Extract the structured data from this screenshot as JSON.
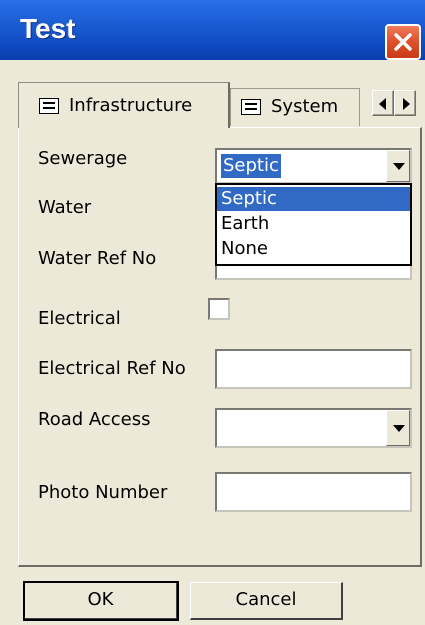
{
  "window": {
    "title": "Test"
  },
  "tabs": [
    {
      "label": "Infrastructure",
      "active": true
    },
    {
      "label": "System",
      "active": false
    }
  ],
  "form": {
    "sewerage": {
      "label": "Sewerage",
      "value": "Septic"
    },
    "water": {
      "label": "Water"
    },
    "water_ref_no": {
      "label": "Water Ref No"
    },
    "electrical": {
      "label": "Electrical",
      "checked": false
    },
    "electrical_ref_no": {
      "label": "Electrical Ref No",
      "value": ""
    },
    "road_access": {
      "label": "Road Access",
      "value": ""
    },
    "photo_number": {
      "label": "Photo Number",
      "value": ""
    }
  },
  "dropdown": {
    "options": [
      "Septic",
      "Earth",
      "None"
    ],
    "selected_index": 0
  },
  "buttons": {
    "ok_label": "OK",
    "cancel_label": "Cancel"
  },
  "colors": {
    "title_bar": "#1d5fd6",
    "selection": "#316ac5",
    "close_button": "#e04f2a",
    "dialog_face": "#ece9d8"
  },
  "icons": {
    "tab_icon": "form-icon",
    "close": "close-icon"
  }
}
